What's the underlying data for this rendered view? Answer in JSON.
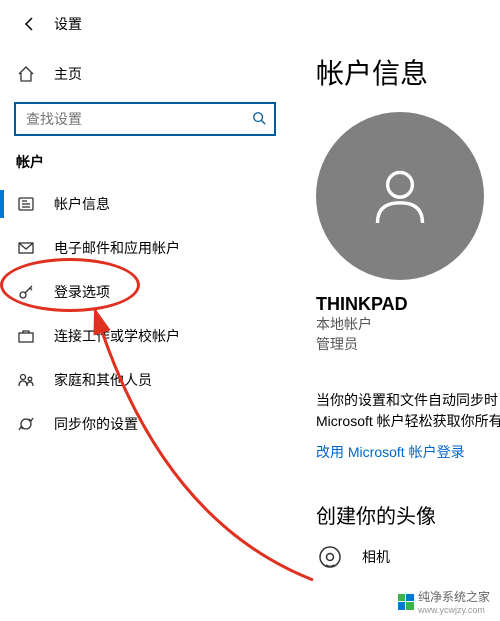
{
  "header": {
    "title": "设置"
  },
  "home": {
    "label": "主页"
  },
  "search": {
    "placeholder": "查找设置"
  },
  "section": {
    "title": "帐户"
  },
  "nav": [
    {
      "icon": "account-info-icon",
      "label": "帐户信息",
      "active": true
    },
    {
      "icon": "email-icon",
      "label": "电子邮件和应用帐户",
      "active": false
    },
    {
      "icon": "key-icon",
      "label": "登录选项",
      "active": false
    },
    {
      "icon": "work-icon",
      "label": "连接工作或学校帐户",
      "active": false
    },
    {
      "icon": "family-icon",
      "label": "家庭和其他人员",
      "active": false
    },
    {
      "icon": "sync-icon",
      "label": "同步你的设置",
      "active": false
    }
  ],
  "page": {
    "title": "帐户信息",
    "username": "THINKPAD",
    "account_type": "本地帐户",
    "account_role": "管理员",
    "sync_text_1": "当你的设置和文件自动同步时，",
    "sync_text_2": "Microsoft 帐户轻松获取你所有",
    "link": "改用 Microsoft 帐户登录",
    "create_title": "创建你的头像",
    "camera": "相机"
  },
  "watermark": {
    "text": "纯净系统之家",
    "url": "www.ycwjzy.com"
  }
}
